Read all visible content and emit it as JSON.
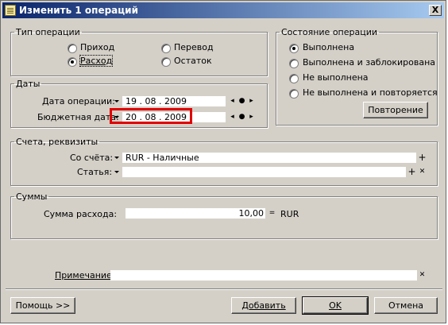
{
  "window": {
    "title": "Изменить 1 операций",
    "close_label": "X"
  },
  "type_group": {
    "legend": "Тип операции",
    "options": [
      {
        "label": "Приход",
        "selected": false
      },
      {
        "label": "Перевод",
        "selected": false
      },
      {
        "label": "Расход",
        "selected": true
      },
      {
        "label": "Остаток",
        "selected": false
      }
    ]
  },
  "state_group": {
    "legend": "Состояние операции",
    "options": [
      {
        "label": "Выполнена",
        "selected": true
      },
      {
        "label": "Выполнена и заблокирована",
        "selected": false
      },
      {
        "label": "Не выполнена",
        "selected": false
      },
      {
        "label": "Не выполнена и повторяется",
        "selected": false
      }
    ],
    "repeat_button": "Повторение"
  },
  "dates_group": {
    "legend": "Даты",
    "operation_date_label": "Дата операции:",
    "operation_date": "19 . 08 . 2009",
    "budget_date_label": "Бюджетная дата:",
    "budget_date": "20 . 08 . 2009"
  },
  "accounts_group": {
    "legend": "Счета, реквизиты",
    "from_account_label": "Со счёта:",
    "from_account": "RUR - Наличные",
    "article_label": "Статья:",
    "article": ""
  },
  "sums_group": {
    "legend": "Суммы",
    "expense_label": "Сумма расхода:",
    "expense_value": "10,00",
    "currency": "RUR"
  },
  "note": {
    "label": "Примечание:",
    "value": ""
  },
  "buttons": {
    "help": "Помощь >>",
    "add": "Добавить",
    "ok": "OK",
    "cancel": "Отмена"
  }
}
